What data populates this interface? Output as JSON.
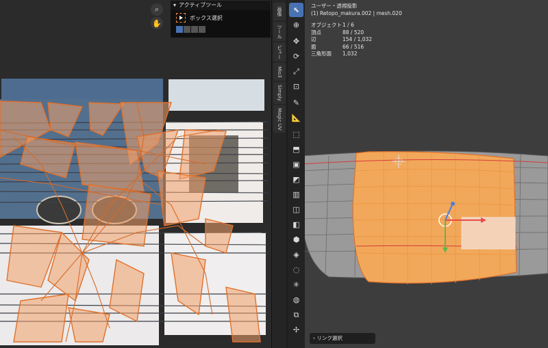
{
  "uv_editor": {
    "active_tool": {
      "header": "アクティブツール",
      "tool_label": "ボックス選択"
    }
  },
  "uv_tabs": [
    "画像",
    "ツール",
    "ビュー",
    "Mio3",
    "Simply",
    "Magic UV"
  ],
  "viewport": {
    "view_name": "ユーザー・透視投影",
    "object_info": "(1) Retopo_makura.002 | mesh.020",
    "stats": [
      {
        "label": "オブジェクト",
        "value": "1 / 6"
      },
      {
        "label": "頂点",
        "value": "88 / 520"
      },
      {
        "label": "辺",
        "value": "154 / 1,032"
      },
      {
        "label": "面",
        "value": "66 / 516"
      },
      {
        "label": "三角形面",
        "value": "1,032"
      }
    ],
    "redo_panel": "リンク選択"
  },
  "toolbar_tools": [
    "select-box",
    "cursor",
    "move",
    "rotate",
    "scale",
    "transform",
    "annotate",
    "measure",
    "add-cube",
    "extrude",
    "inset",
    "bevel",
    "loop-cut",
    "knife",
    "poly-build",
    "spin",
    "smooth",
    "edge-slide",
    "shrink-fatten",
    "shear",
    "rip"
  ],
  "colors": {
    "accent": "#4772b3",
    "selection": "#ff8a3d",
    "mesh_face": "#f2a85a"
  }
}
